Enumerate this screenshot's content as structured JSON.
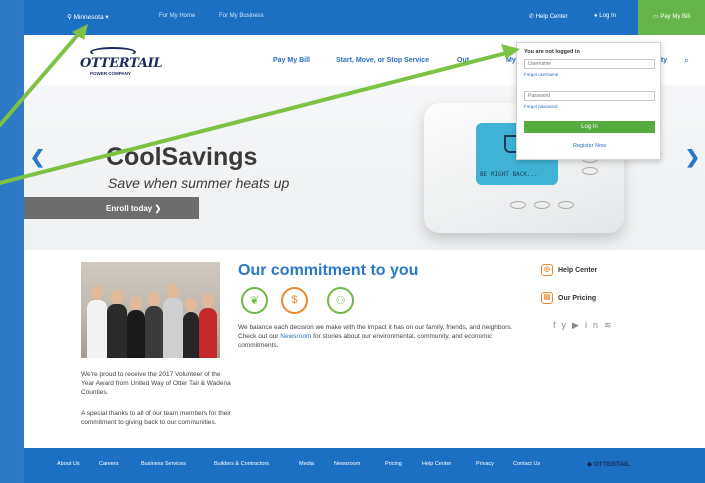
{
  "topbar": {
    "region": "Minnesota",
    "for_my_home": "For My Home",
    "for_my_business": "For My Business",
    "help_center": "Help Center",
    "log_in": "Log In",
    "pay_my_bill": "Pay My Bill"
  },
  "logo": {
    "name": "OTTERTAIL",
    "sub": "POWER COMPANY"
  },
  "nav": {
    "pay_bill": "Pay My Bill",
    "start_move_stop": "Start, Move, or Stop Service",
    "outages": "Out",
    "my": "My",
    "safety": "ety"
  },
  "hero": {
    "title": "CoolSavings",
    "tagline": "Save when summer heats up",
    "cta": "Enroll today",
    "cta_arrow": "❯",
    "screen_text": "BE RIGHT BACK..."
  },
  "login": {
    "heading": "You are not logged in",
    "username_placeholder": "Username",
    "forgot_username": "Forgot username",
    "password_placeholder": "Password",
    "forgot_password": "Forgot password",
    "button": "Log In",
    "register": "Register Now"
  },
  "photo_caption": "We're proud to receive the 2017 Volunteer of the Year Award from United Way of Otter Tail & Wadena Counties.",
  "photo_caption2": "A special thanks to all of our team members for their commitment to giving back to our communities.",
  "commitment": {
    "title": "Our commitment to you",
    "text_before": "We balance each decision we make with the impact it has on our family, friends, and neighbors. Check out our ",
    "link": "Newsroom",
    "text_after": " for stories about our environmental, community, and economic commitments."
  },
  "side": {
    "help_center": "Help Center",
    "our_pricing": "Our Pricing"
  },
  "footer": {
    "links": [
      "About Us",
      "Careers",
      "Business Services",
      "Builders & Contractors",
      "Media",
      "Newsroom",
      "Pricing",
      "Help Center",
      "Privacy",
      "Contact Us"
    ],
    "logo": "OTTERTAIL"
  },
  "colors": {
    "brand_blue": "#1d6fc4",
    "pay_green": "#65b54a",
    "annotation_green": "#7dc242",
    "accent_orange": "#e98a2d"
  },
  "icons": {
    "region": "map-pin-icon",
    "help": "phone-icon",
    "login": "user-icon",
    "pay": "credit-card-icon",
    "search": "search-icon",
    "prev": "chevron-left-icon",
    "next": "chevron-right-icon",
    "social": [
      "facebook-icon",
      "twitter-icon",
      "youtube-icon",
      "linkedin-icon",
      "rss-icon"
    ]
  }
}
